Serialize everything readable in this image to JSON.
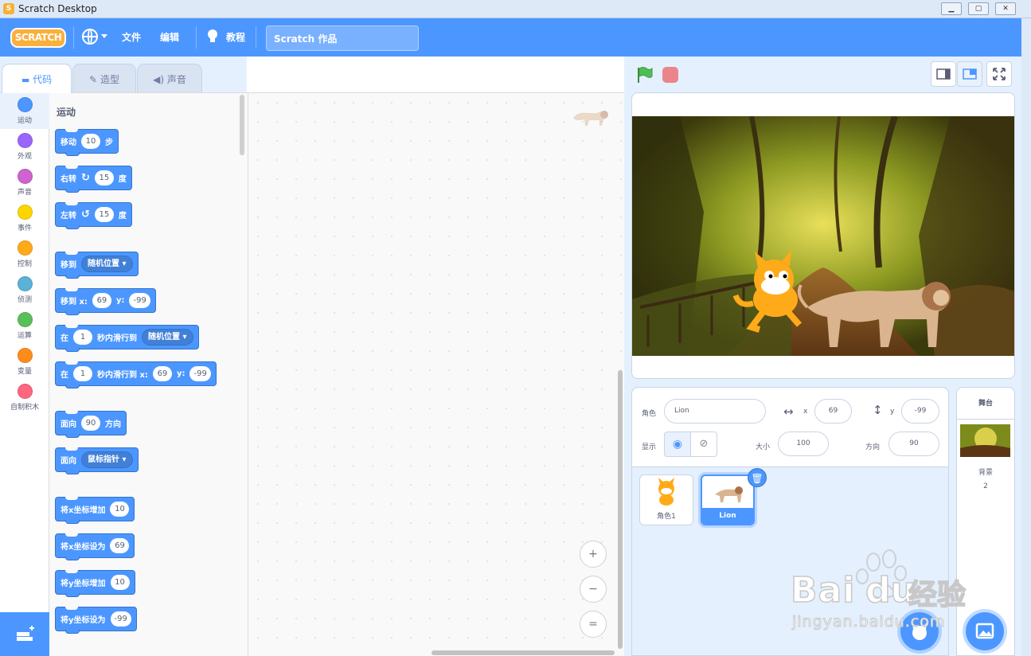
{
  "window": {
    "title": "Scratch Desktop",
    "min": "▁",
    "max": "▢",
    "close": "✕"
  },
  "menubar": {
    "logo": "SCRATCH",
    "file": "文件",
    "edit": "编辑",
    "tutorials": "教程",
    "project_title": "Scratch 作品"
  },
  "tabs": [
    {
      "label": "代码",
      "icon": "code-icon"
    },
    {
      "label": "造型",
      "icon": "brush-icon"
    },
    {
      "label": "声音",
      "icon": "speaker-icon"
    }
  ],
  "categories": [
    {
      "label": "运动",
      "color": "#4c97ff"
    },
    {
      "label": "外观",
      "color": "#9966ff"
    },
    {
      "label": "声音",
      "color": "#cf63cf"
    },
    {
      "label": "事件",
      "color": "#ffd500"
    },
    {
      "label": "控制",
      "color": "#ffab19"
    },
    {
      "label": "侦测",
      "color": "#5cb1d6"
    },
    {
      "label": "运算",
      "color": "#59c059"
    },
    {
      "label": "变量",
      "color": "#ff8c1a"
    },
    {
      "label": "自制积木",
      "color": "#ff6680"
    }
  ],
  "palette": {
    "header": "运动",
    "move": {
      "a": "移动",
      "v": "10",
      "b": "步"
    },
    "turn_right": {
      "a": "右转",
      "v": "15",
      "b": "度"
    },
    "turn_left": {
      "a": "左转",
      "v": "15",
      "b": "度"
    },
    "goto": {
      "a": "移到",
      "d": "随机位置"
    },
    "goto_xy": {
      "a": "移到 x:",
      "x": "69",
      "b": "y:",
      "y": "-99"
    },
    "glide_to": {
      "a": "在",
      "v": "1",
      "b": "秒内滑行到",
      "d": "随机位置"
    },
    "glide_xy": {
      "a": "在",
      "v": "1",
      "b": "秒内滑行到 x:",
      "x": "69",
      "c": "y:",
      "y": "-99"
    },
    "point_dir": {
      "a": "面向",
      "v": "90",
      "b": "方向"
    },
    "point_towards": {
      "a": "面向",
      "d": "鼠标指针"
    },
    "change_x": {
      "a": "将x坐标增加",
      "v": "10"
    },
    "set_x": {
      "a": "将x坐标设为",
      "v": "69"
    },
    "change_y": {
      "a": "将y坐标增加",
      "v": "10"
    },
    "set_y": {
      "a": "将y坐标设为",
      "v": "-99"
    }
  },
  "workspace": {
    "zoom_in": "+",
    "zoom_out": "−",
    "zoom_reset": "="
  },
  "sprite_info": {
    "sprite_label": "角色",
    "sprite_name": "Lion",
    "x_label": "x",
    "x": "69",
    "y_label": "y",
    "y": "-99",
    "show_label": "显示",
    "size_label": "大小",
    "size": "100",
    "direction_label": "方向",
    "direction": "90"
  },
  "sprites": [
    {
      "name": "角色1",
      "selected": false
    },
    {
      "name": "Lion",
      "selected": true
    }
  ],
  "stage_panel": {
    "title": "舞台",
    "backdrops_label": "背景",
    "backdrops_count": "2"
  },
  "watermark": {
    "brand": "Bai",
    "brand2": "du",
    "cn": "经验",
    "url": "jingyan.baidu.com"
  }
}
